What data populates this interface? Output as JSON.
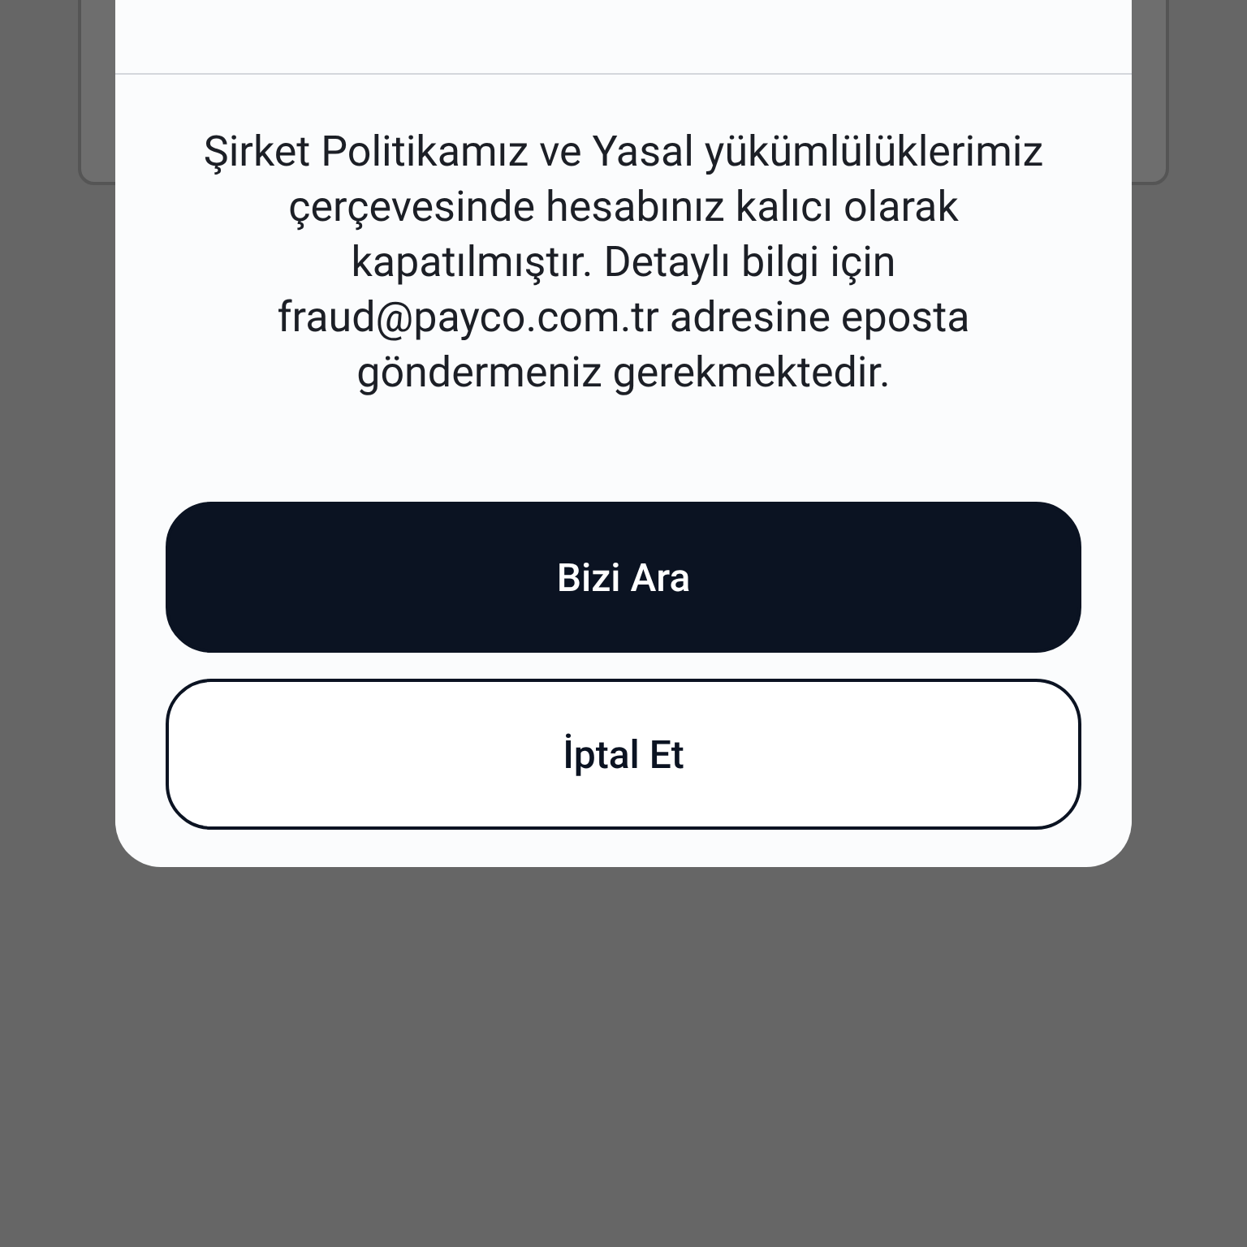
{
  "dialog": {
    "message": "Şirket Politikamız ve Yasal yükümlülüklerimiz çerçevesinde hesabınız kalıcı olarak kapatılmıştır. Detaylı bilgi için fraud@payco.com.tr adresine eposta göndermeniz gerekmektedir.",
    "buttons": [
      {
        "label": "Bizi Ara",
        "kind": "primary"
      },
      {
        "label": "İptal Et",
        "kind": "secondary"
      }
    ]
  }
}
